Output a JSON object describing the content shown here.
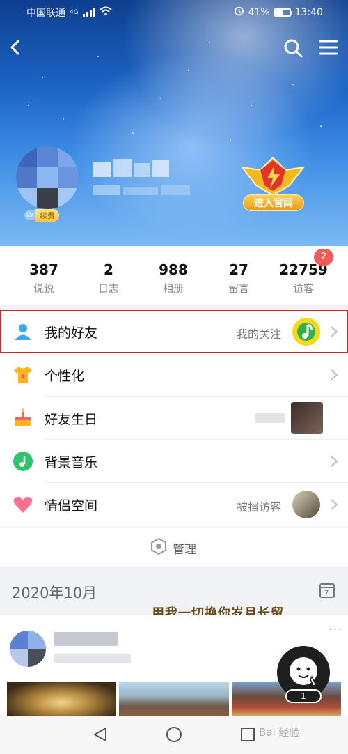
{
  "status_bar": {
    "carrier": "中国联通",
    "network": "4G",
    "battery_percent": "41%",
    "time": "13:40"
  },
  "header": {
    "level_badge": "LV",
    "renew_label": "续费",
    "official_label": "进入官网"
  },
  "stats": [
    {
      "value": "387",
      "label": "说说"
    },
    {
      "value": "2",
      "label": "日志"
    },
    {
      "value": "988",
      "label": "相册"
    },
    {
      "value": "27",
      "label": "留言"
    },
    {
      "value": "22759",
      "label": "访客"
    }
  ],
  "visitor_badge": "2",
  "menu_rows": [
    {
      "label": "我的好友",
      "right_text": "我的关注"
    },
    {
      "label": "个性化",
      "right_text": ""
    },
    {
      "label": "好友生日",
      "right_text": ""
    },
    {
      "label": "背景音乐",
      "right_text": ""
    },
    {
      "label": "情侣空间",
      "right_text": "被挡访客"
    }
  ],
  "manage_label": "管理",
  "feed": {
    "date": "2020年10月",
    "banner_text": "用我一切换你岁月长留",
    "more": "···"
  },
  "floating": {
    "count": "1"
  },
  "watermark": "Bai 经验",
  "colors": {
    "highlight_border": "#c9282d",
    "badge_red": "#f35a5a",
    "header_blue": "#1c64c5"
  }
}
